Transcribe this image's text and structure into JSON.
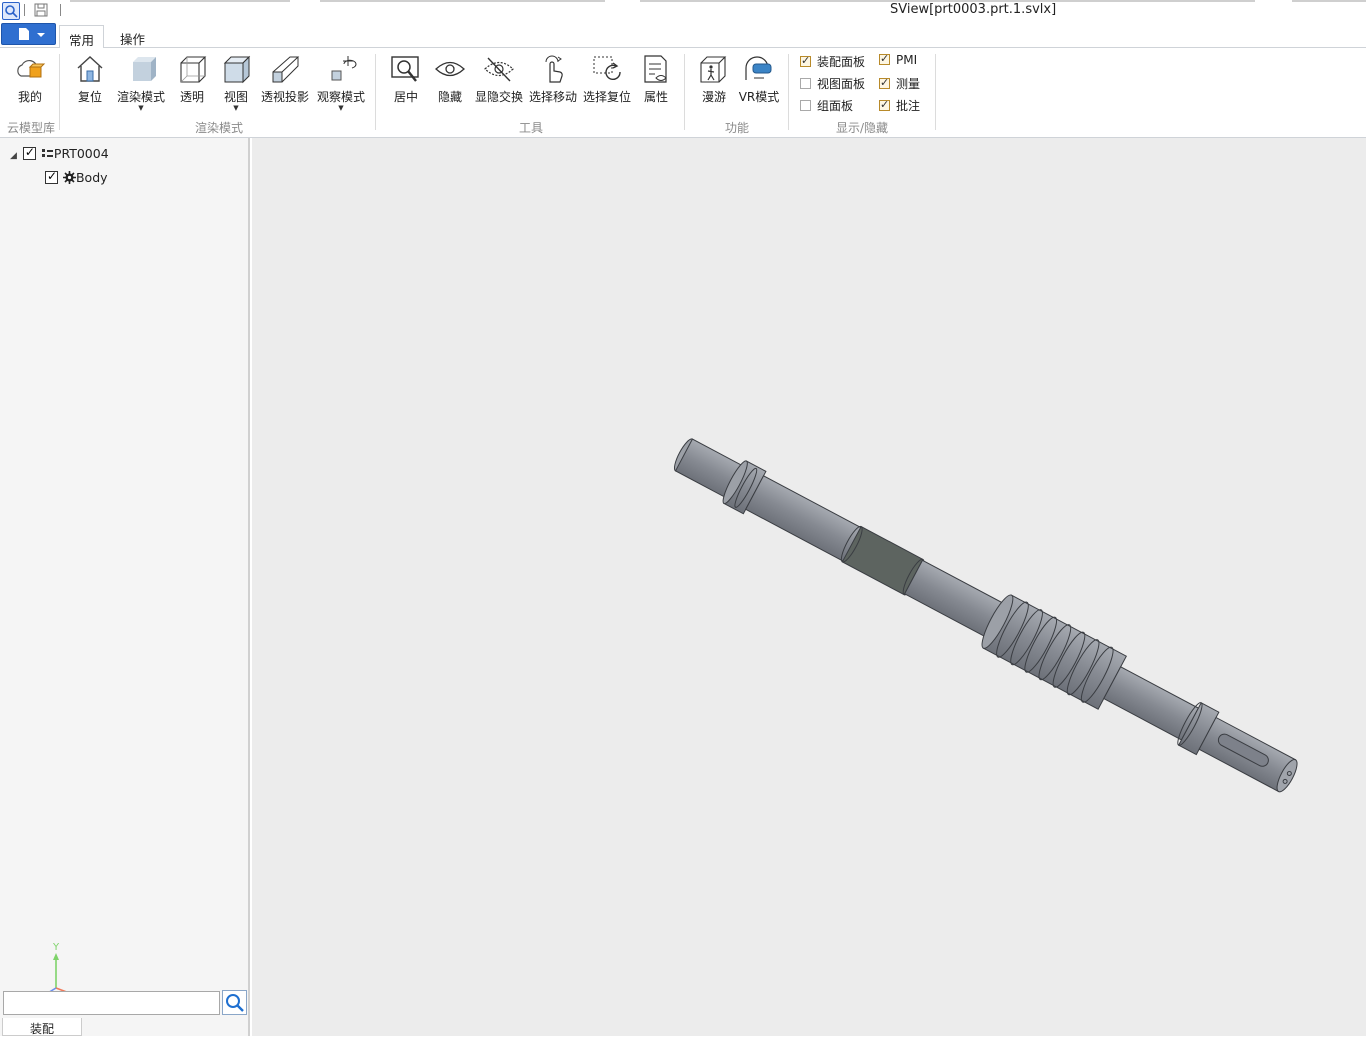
{
  "window": {
    "title": "SView[prt0003.prt.1.svlx]"
  },
  "tabs": [
    {
      "label": "常用"
    },
    {
      "label": "操作"
    }
  ],
  "ribbon": {
    "cloud": {
      "my_label": "我的",
      "group": "云模型库"
    },
    "render": {
      "group": "渲染模式",
      "reset": "复位",
      "render_mode": "渲染模式",
      "transparent": "透明",
      "view": "视图",
      "perspective": "透视投影",
      "observe_mode": "观察模式"
    },
    "tools": {
      "group": "工具",
      "center": "居中",
      "hide": "隐藏",
      "swap_visibility": "显隐交换",
      "select_move": "选择移动",
      "select_reset": "选择复位",
      "properties": "属性"
    },
    "features": {
      "group": "功能",
      "roam": "漫游",
      "vr": "VR模式"
    },
    "display": {
      "group": "显示/隐藏",
      "checks": [
        {
          "label": "装配面板",
          "checked": true
        },
        {
          "label": "视图面板",
          "checked": false
        },
        {
          "label": "组面板",
          "checked": false
        },
        {
          "label": "PMI",
          "checked": true
        },
        {
          "label": "测量",
          "checked": true
        },
        {
          "label": "批注",
          "checked": true
        }
      ]
    }
  },
  "tree": {
    "root": {
      "label": "PRT0004",
      "checked": true,
      "expanded": true
    },
    "child": {
      "label": "Body",
      "checked": true
    }
  },
  "panel": {
    "search_placeholder": "",
    "bottom_tab": "装配"
  },
  "axis": {
    "y_label": "Y"
  },
  "colors": {
    "accent": "#2f6fd0",
    "part": "#8a8e96",
    "viewport_bg": "#ececec"
  }
}
